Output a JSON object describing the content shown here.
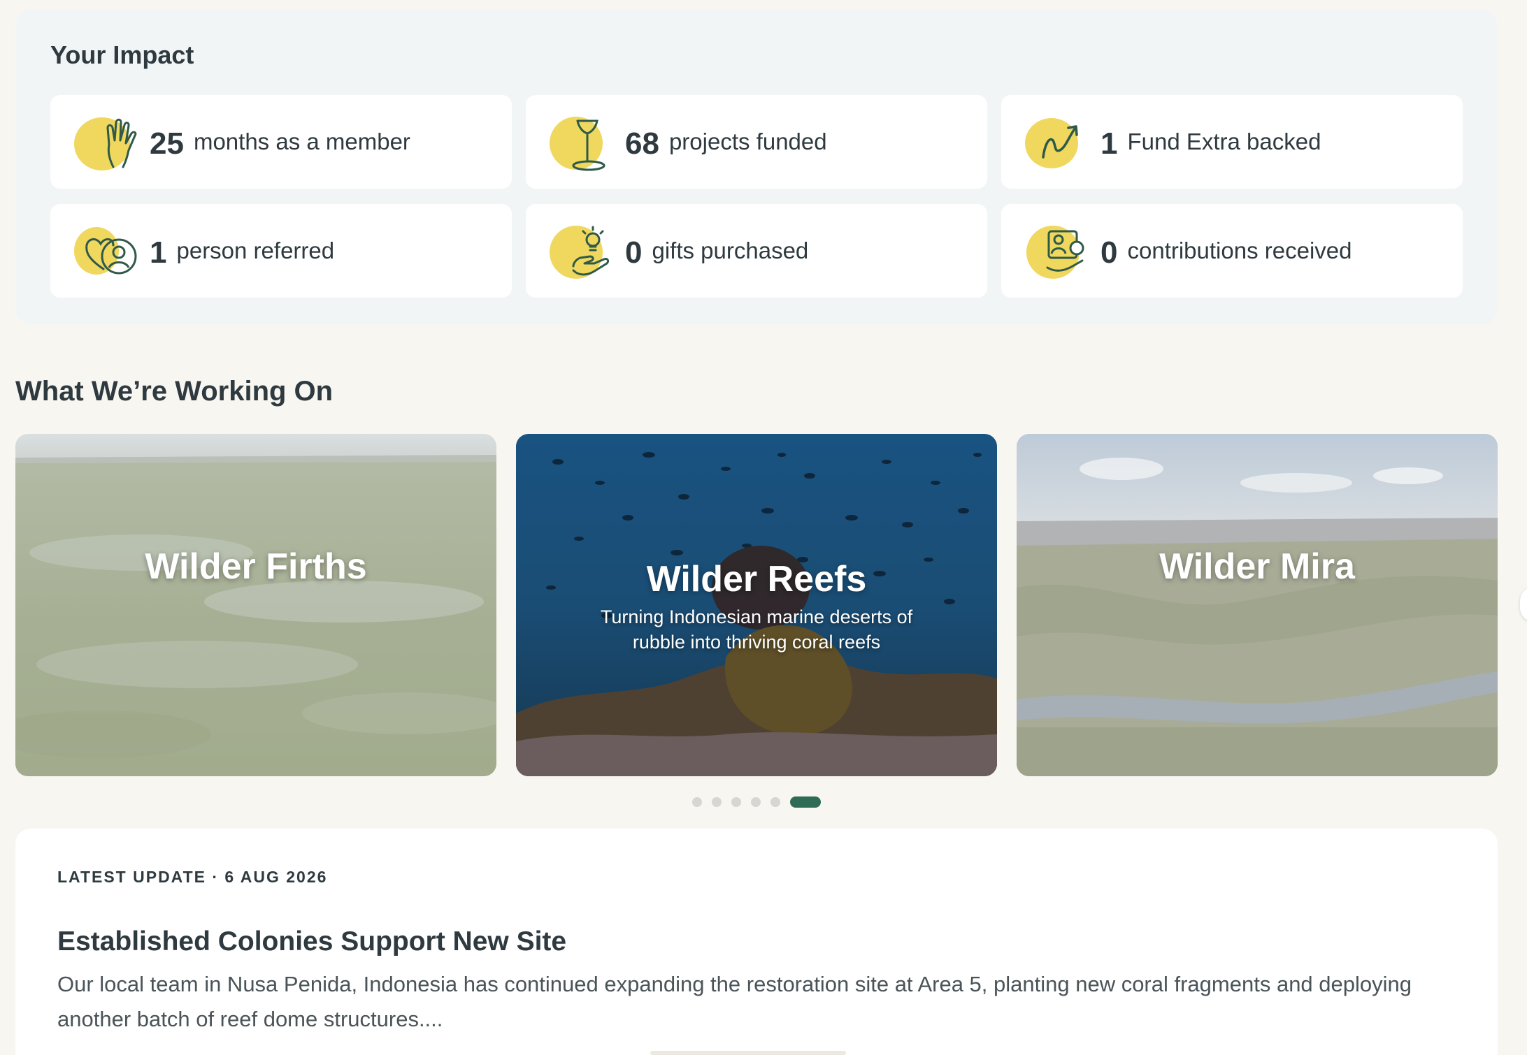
{
  "impact": {
    "title": "Your Impact",
    "stats": [
      {
        "number": "25",
        "label": "months as a member",
        "icon": "hand-icon"
      },
      {
        "number": "68",
        "label": "projects funded",
        "icon": "sapling-stake-icon"
      },
      {
        "number": "1",
        "label": "Fund Extra backed",
        "icon": "growth-arrow-icon"
      },
      {
        "number": "1",
        "label": "person referred",
        "icon": "heart-person-icon"
      },
      {
        "number": "0",
        "label": "gifts purchased",
        "icon": "hand-lightbulb-icon"
      },
      {
        "number": "0",
        "label": "contributions received",
        "icon": "person-pound-icon"
      }
    ],
    "icon_colors": {
      "blob": "#f0d75e",
      "line": "#2f5a48"
    }
  },
  "working_on": {
    "title": "What We’re Working On",
    "projects": [
      {
        "title": "Wilder Firths",
        "description": ""
      },
      {
        "title": "Wilder Reefs",
        "description": "Turning Indonesian marine deserts of rubble into thriving coral reefs"
      },
      {
        "title": "Wilder Mira",
        "description": ""
      }
    ],
    "carousel": {
      "total_dots": 6,
      "active_index": 5
    }
  },
  "latest_update": {
    "meta": "LATEST UPDATE · 6 AUG 2026",
    "title": "Established Colonies Support New Site",
    "body": "Our local team in Nusa Penida, Indonesia has continued expanding the restoration site at Area 5, planting new coral fragments and deploying another batch of reef dome structures...."
  },
  "colors": {
    "page_bg": "#f8f6f1",
    "panel_bg": "#f2f5f6",
    "text": "#2e3a3f",
    "accent": "#2f6b55"
  }
}
